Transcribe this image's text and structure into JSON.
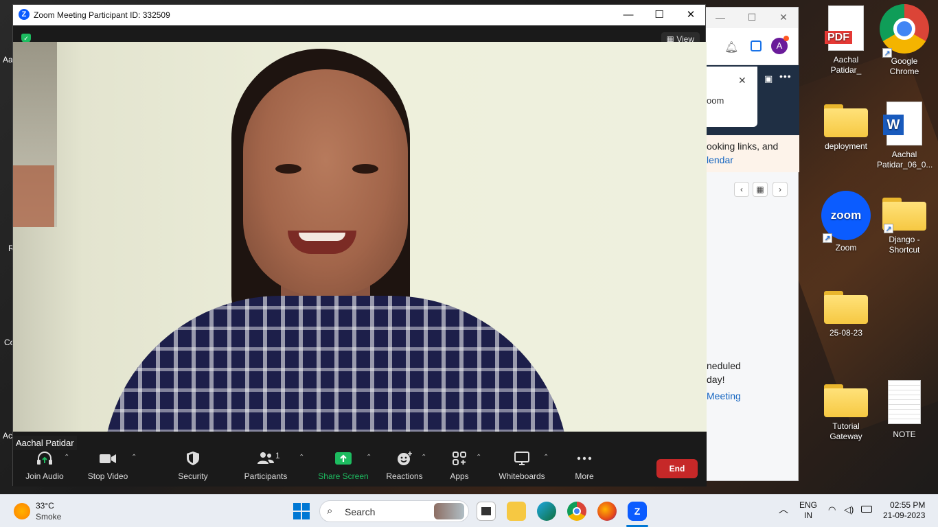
{
  "desktop": {
    "left_labels": [
      "Aa",
      "R",
      "Co",
      "Ac"
    ],
    "icons": [
      {
        "label": "Aachal Patidar_",
        "type": "pdf",
        "badge": "PDF"
      },
      {
        "label": "Google Chrome",
        "type": "chrome"
      },
      {
        "label": "deployment",
        "type": "folder"
      },
      {
        "label": "Aachal Patidar_06_0...",
        "type": "word",
        "badge": "W"
      },
      {
        "label": "Zoom",
        "type": "zoom",
        "badge": "zoom"
      },
      {
        "label": "Django - Shortcut",
        "type": "folder"
      },
      {
        "label": "25-08-23",
        "type": "folder"
      },
      {
        "label": "Tutorial Gateway",
        "type": "folder"
      },
      {
        "label": "NOTE",
        "type": "text-file"
      }
    ]
  },
  "background_window": {
    "avatar_letter": "A",
    "popup_text": "oom",
    "banner_line1": "ooking links, and",
    "banner_link": "lendar",
    "body_line1": "neduled",
    "body_line2": "day!",
    "body_link": "Meeting"
  },
  "zoom": {
    "title": "Zoom Meeting Participant ID: 332509",
    "logo": "Z",
    "view_label": "View",
    "participant_name": "Aachal Patidar",
    "toolbar": {
      "join_audio": "Join Audio",
      "stop_video": "Stop Video",
      "security": "Security",
      "participants": "Participants",
      "participants_count": "1",
      "share_screen": "Share Screen",
      "reactions": "Reactions",
      "apps": "Apps",
      "whiteboards": "Whiteboards",
      "more": "More",
      "end": "End"
    }
  },
  "taskbar": {
    "temperature": "33°C",
    "weather": "Smoke",
    "search_label": "Search",
    "language_line1": "ENG",
    "language_line2": "IN",
    "time": "02:55 PM",
    "date": "21-09-2023"
  },
  "colors": {
    "zoom_blue": "#0b5cff",
    "share_green": "#1dbc60",
    "end_red": "#c62828",
    "folder_yellow": "#f6c842"
  }
}
